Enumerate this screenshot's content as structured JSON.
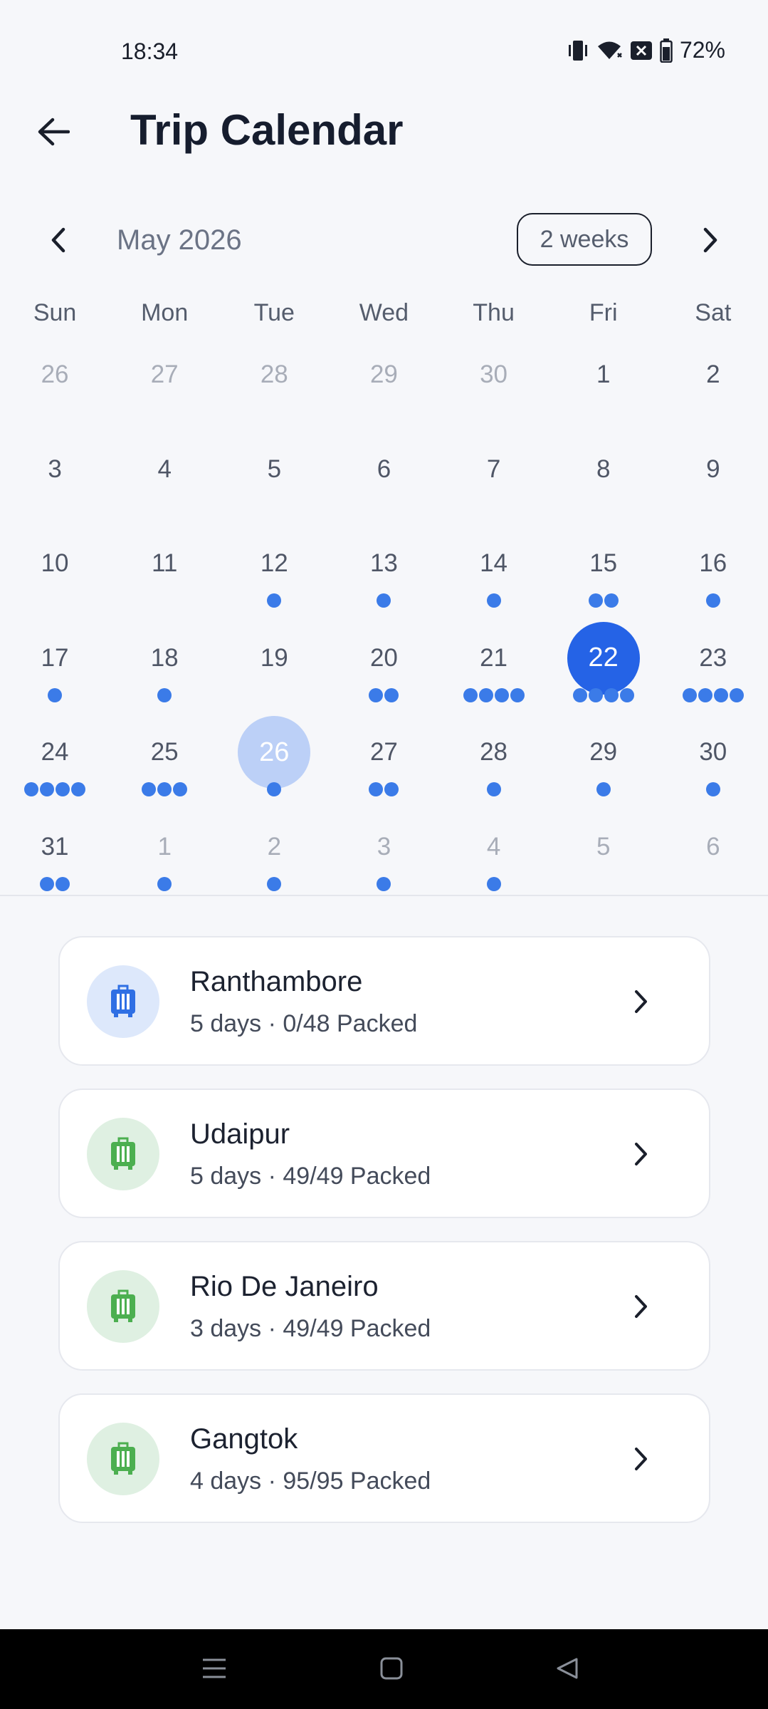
{
  "status_bar": {
    "time": "18:34",
    "battery": "72%"
  },
  "app_bar": {
    "title": "Trip Calendar"
  },
  "calendar": {
    "month_label": "May 2026",
    "range_toggle": "2 weeks",
    "weekdays": [
      "Sun",
      "Mon",
      "Tue",
      "Wed",
      "Thu",
      "Fri",
      "Sat"
    ],
    "weeks": [
      [
        {
          "d": "26",
          "m": true,
          "dots": 0
        },
        {
          "d": "27",
          "m": true,
          "dots": 0
        },
        {
          "d": "28",
          "m": true,
          "dots": 0
        },
        {
          "d": "29",
          "m": true,
          "dots": 0
        },
        {
          "d": "30",
          "m": true,
          "dots": 0
        },
        {
          "d": "1",
          "m": false,
          "dots": 0
        },
        {
          "d": "2",
          "m": false,
          "dots": 0
        }
      ],
      [
        {
          "d": "3",
          "m": false,
          "dots": 0
        },
        {
          "d": "4",
          "m": false,
          "dots": 0
        },
        {
          "d": "5",
          "m": false,
          "dots": 0
        },
        {
          "d": "6",
          "m": false,
          "dots": 0
        },
        {
          "d": "7",
          "m": false,
          "dots": 0
        },
        {
          "d": "8",
          "m": false,
          "dots": 0
        },
        {
          "d": "9",
          "m": false,
          "dots": 0
        }
      ],
      [
        {
          "d": "10",
          "m": false,
          "dots": 0
        },
        {
          "d": "11",
          "m": false,
          "dots": 0
        },
        {
          "d": "12",
          "m": false,
          "dots": 1
        },
        {
          "d": "13",
          "m": false,
          "dots": 1
        },
        {
          "d": "14",
          "m": false,
          "dots": 1
        },
        {
          "d": "15",
          "m": false,
          "dots": 2
        },
        {
          "d": "16",
          "m": false,
          "dots": 1
        }
      ],
      [
        {
          "d": "17",
          "m": false,
          "dots": 1
        },
        {
          "d": "18",
          "m": false,
          "dots": 1
        },
        {
          "d": "19",
          "m": false,
          "dots": 0
        },
        {
          "d": "20",
          "m": false,
          "dots": 2
        },
        {
          "d": "21",
          "m": false,
          "dots": 4
        },
        {
          "d": "22",
          "m": false,
          "dots": 4,
          "state": "selected"
        },
        {
          "d": "23",
          "m": false,
          "dots": 4
        }
      ],
      [
        {
          "d": "24",
          "m": false,
          "dots": 4
        },
        {
          "d": "25",
          "m": false,
          "dots": 3
        },
        {
          "d": "26",
          "m": false,
          "dots": 1,
          "state": "today"
        },
        {
          "d": "27",
          "m": false,
          "dots": 2
        },
        {
          "d": "28",
          "m": false,
          "dots": 1
        },
        {
          "d": "29",
          "m": false,
          "dots": 1
        },
        {
          "d": "30",
          "m": false,
          "dots": 1
        }
      ],
      [
        {
          "d": "31",
          "m": false,
          "dots": 2
        },
        {
          "d": "1",
          "m": true,
          "dots": 1
        },
        {
          "d": "2",
          "m": true,
          "dots": 1
        },
        {
          "d": "3",
          "m": true,
          "dots": 1
        },
        {
          "d": "4",
          "m": true,
          "dots": 1
        },
        {
          "d": "5",
          "m": true,
          "dots": 0
        },
        {
          "d": "6",
          "m": true,
          "dots": 0
        }
      ]
    ]
  },
  "trips": [
    {
      "name": "Ranthambore",
      "meta": "5 days · 0/48 Packed",
      "icon": "luggage-icon",
      "color": "#2f6fe4",
      "tone": "blue"
    },
    {
      "name": "Udaipur",
      "meta": "5 days · 49/49 Packed",
      "icon": "luggage-icon",
      "color": "#4caf50",
      "tone": "green"
    },
    {
      "name": "Rio De Janeiro",
      "meta": "3 days · 49/49 Packed",
      "icon": "luggage-icon",
      "color": "#4caf50",
      "tone": "green"
    },
    {
      "name": "Gangtok",
      "meta": "4 days · 95/95 Packed",
      "icon": "luggage-icon",
      "color": "#4caf50",
      "tone": "green"
    }
  ],
  "colors": {
    "accent": "#2563e6",
    "dot": "#3b7be8",
    "today": "#bcd0f7",
    "packed": "#4caf50"
  }
}
